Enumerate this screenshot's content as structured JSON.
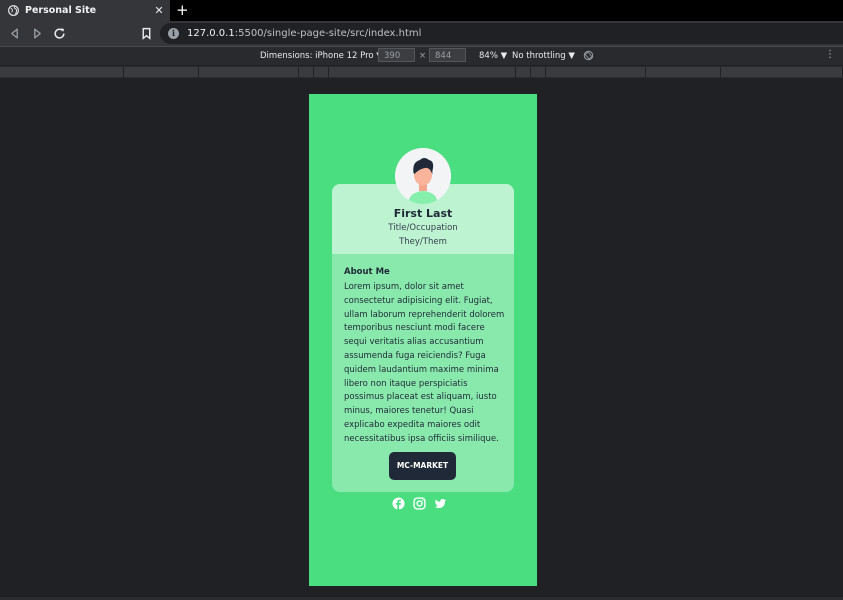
{
  "browser": {
    "tab_title": "Personal Site",
    "tab_close": "✕",
    "new_tab": "+",
    "url_host": "127.0.0.1",
    "url_rest": ":5500/single-page-site/src/index.html"
  },
  "devtools": {
    "dimensions_label": "Dimensions: iPhone 12 Pro ▼",
    "width_value": "390",
    "times": "×",
    "height_value": "844",
    "zoom": "84% ▼",
    "throttling": "No throttling ▼",
    "menu": "⋮"
  },
  "profile": {
    "name": "First Last",
    "occupation": "Title/Occupation",
    "pronouns": "They/Them",
    "about_heading": "About Me",
    "about_text": "Lorem ipsum, dolor sit amet consectetur adipisicing elit. Fugiat, ullam laborum reprehenderit dolorem temporibus nesciunt modi facere sequi veritatis alias accusantium assumenda fuga reiciendis? Fuga quidem laudantium maxime minima libero non itaque perspiciatis possimus placeat est aliquam, iusto minus, maiores tenetur! Quasi explicabo expedita maiores odit necessitatibus ipsa officiis similique.",
    "button_label": "MC-MARKET"
  },
  "socials": [
    "facebook-icon",
    "instagram-icon",
    "twitter-icon"
  ],
  "colors": {
    "page_bg": "#4ade80",
    "button_bg": "#1f2937",
    "chrome_bg": "#35363a"
  }
}
